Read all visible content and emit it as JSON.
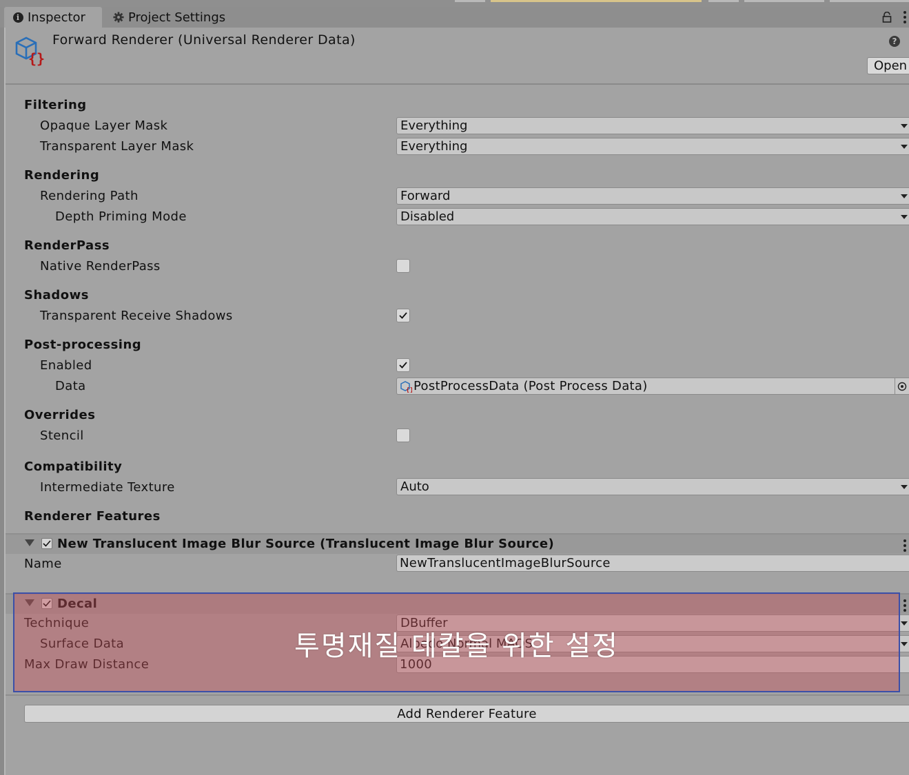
{
  "tabs": [
    {
      "label": "Inspector",
      "icon": "info-icon"
    },
    {
      "label": "Project Settings",
      "icon": "gear-icon"
    }
  ],
  "header": {
    "title": "Forward Renderer (Universal Renderer Data)",
    "open_label": "Open",
    "help_icon": "?"
  },
  "sections": {
    "filtering": {
      "title": "Filtering",
      "opaque_label": "Opaque Layer Mask",
      "opaque_value": "Everything",
      "transparent_label": "Transparent Layer Mask",
      "transparent_value": "Everything"
    },
    "rendering": {
      "title": "Rendering",
      "path_label": "Rendering Path",
      "path_value": "Forward",
      "depth_label": "Depth Priming Mode",
      "depth_value": "Disabled"
    },
    "renderpass": {
      "title": "RenderPass",
      "native_label": "Native RenderPass",
      "native_checked": false
    },
    "shadows": {
      "title": "Shadows",
      "receive_label": "Transparent Receive Shadows",
      "receive_checked": true
    },
    "postprocessing": {
      "title": "Post-processing",
      "enabled_label": "Enabled",
      "enabled_checked": true,
      "data_label": "Data",
      "data_value": "PostProcessData (Post Process Data)"
    },
    "overrides": {
      "title": "Overrides",
      "stencil_label": "Stencil",
      "stencil_checked": false
    },
    "compatibility": {
      "title": "Compatibility",
      "intermediate_label": "Intermediate Texture",
      "intermediate_value": "Auto"
    },
    "features": {
      "title": "Renderer Features"
    }
  },
  "features": [
    {
      "title": "New Translucent Image Blur Source (Translucent Image Blur Source)",
      "enabled": true,
      "name_label": "Name",
      "name_value": "NewTranslucentImageBlurSource"
    },
    {
      "title": "Decal",
      "enabled": true,
      "technique_label": "Technique",
      "technique_value": "DBuffer",
      "surface_label": "Surface Data",
      "surface_value": "Albedo Normal MAOS",
      "maxdraw_label": "Max Draw Distance",
      "maxdraw_value": "1000"
    }
  ],
  "add_feature_label": "Add Renderer Feature",
  "annotation": {
    "text": "투명재질 데칼을 위한 설정",
    "fill_color": "#c8505a",
    "border_color": "#3b4fa8"
  }
}
